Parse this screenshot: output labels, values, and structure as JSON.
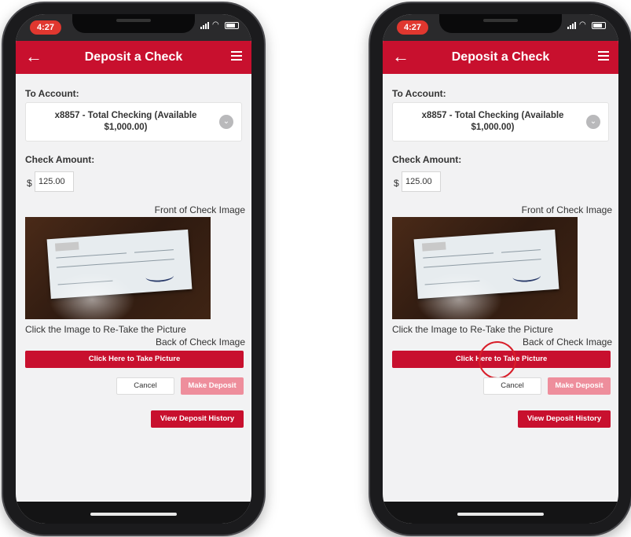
{
  "status": {
    "time": "4:27"
  },
  "header": {
    "title": "Deposit a Check"
  },
  "form": {
    "to_account_label": "To Account:",
    "account_line1": "x8857 - Total Checking (Available",
    "account_line2": "$1,000.00)",
    "check_amount_label": "Check Amount:",
    "currency_symbol": "$",
    "amount_value": "125.00",
    "front_image_label": "Front of Check Image",
    "retake_hint": "Click the Image to Re-Take the Picture",
    "back_image_label": "Back of Check Image"
  },
  "buttons": {
    "take_picture": "Click Here to Take Picture",
    "cancel": "Cancel",
    "make_deposit": "Make Deposit",
    "view_history": "View Deposit History"
  },
  "colors": {
    "brand": "#c8102e",
    "disabled_button": "#ee8e9c",
    "time_pill": "#e0372f"
  },
  "icons": [
    "back-arrow-icon",
    "menu-icon",
    "chevron-down-icon",
    "signal-icon",
    "wifi-icon",
    "battery-icon"
  ]
}
